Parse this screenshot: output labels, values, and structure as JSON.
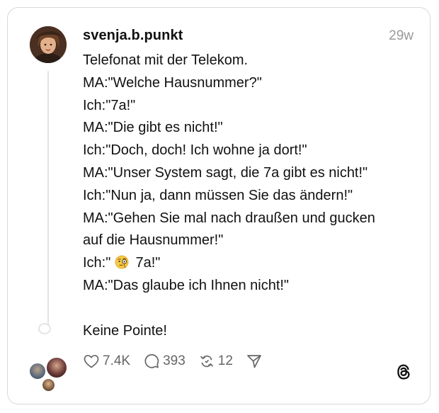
{
  "post": {
    "username": "svenja.b.punkt",
    "timestamp": "29w",
    "lines": [
      "Telefonat mit der Telekom.",
      "MA:\"Welche Hausnummer?\"",
      "Ich:\"7a!\"",
      "MA:\"Die gibt es nicht!\"",
      "Ich:\"Doch, doch! Ich wohne ja dort!\"",
      "MA:\"Unser System sagt, die 7a gibt es nicht!\"",
      "Ich:\"Nun ja, dann müssen Sie das ändern!\"",
      "MA:\"Gehen Sie mal nach draußen und gucken",
      "auf die Hausnummer!\"",
      "Ich:\"",
      "7a!\"",
      "MA:\"Das glaube ich Ihnen nicht!\"",
      "",
      "Keine Pointe!"
    ]
  },
  "actions": {
    "likes": "7.4K",
    "replies": "393",
    "reposts": "12"
  },
  "icons": {
    "like": "heart-icon",
    "reply": "comment-icon",
    "repost": "repost-icon",
    "share": "send-icon",
    "brand": "threads-logo-icon",
    "emoji": "face-with-monocle-emoji"
  },
  "colors": {
    "text": "#111111",
    "muted": "#999999",
    "action": "#666666",
    "border": "#d9d9d9"
  }
}
